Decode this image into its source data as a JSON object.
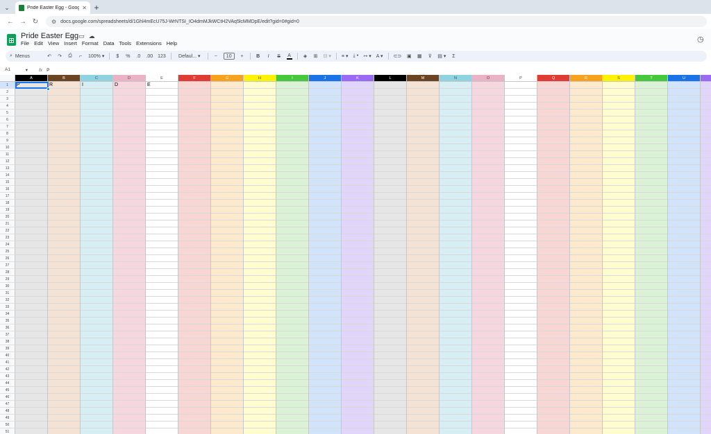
{
  "browser": {
    "tab_title": "Pride Easter Egg - Google Sheets",
    "url": "docs.google.com/spreadsheets/d/1Ghl4mEcU75J-WrNTSI_IO4dmMJkWCtH2VAq5lcMMDpE/edit?gid=0#gid=0"
  },
  "app": {
    "title": "Pride Easter Egg",
    "menu": [
      "File",
      "Edit",
      "View",
      "Insert",
      "Format",
      "Data",
      "Tools",
      "Extensions",
      "Help"
    ]
  },
  "toolbar": {
    "search_label": "Menus",
    "zoom": "100%",
    "currency": "$",
    "percent": "%",
    "decimal_decrease": ".0",
    "decimal_increase": ".00",
    "number_format": "123",
    "font": "Defaul...",
    "font_size": "10",
    "bold": "B",
    "italic": "I",
    "strike": "S",
    "text_color": "A",
    "sum": "Σ"
  },
  "formula_bar": {
    "name_box": "A1",
    "fx": "fx",
    "value": "P"
  },
  "grid": {
    "columns": [
      {
        "label": "A",
        "header_color": "#000000",
        "header_text": "#ffffff",
        "fill": "#e6e6e6"
      },
      {
        "label": "B",
        "header_color": "#6b4423",
        "header_text": "#ffffff",
        "fill": "#f4e3d5"
      },
      {
        "label": "C",
        "header_color": "#8fd3e3",
        "header_text": "#444746",
        "fill": "#d8eef5"
      },
      {
        "label": "D",
        "header_color": "#eab2c4",
        "header_text": "#444746",
        "fill": "#f6d7e0"
      },
      {
        "label": "E",
        "header_color": "#ffffff",
        "header_text": "#444746",
        "fill": "#ffffff"
      },
      {
        "label": "F",
        "header_color": "#e03b35",
        "header_text": "#ffffff",
        "fill": "#f8d6d4"
      },
      {
        "label": "G",
        "header_color": "#f7a11c",
        "header_text": "#ffffff",
        "fill": "#fde9cc"
      },
      {
        "label": "H",
        "header_color": "#fff200",
        "header_text": "#444746",
        "fill": "#fffccf"
      },
      {
        "label": "I",
        "header_color": "#45c83b",
        "header_text": "#ffffff",
        "fill": "#dcf2d7"
      },
      {
        "label": "J",
        "header_color": "#1a73e8",
        "header_text": "#ffffff",
        "fill": "#d2e3fc"
      },
      {
        "label": "K",
        "header_color": "#9a6af5",
        "header_text": "#ffffff",
        "fill": "#e1d5fb"
      },
      {
        "label": "L",
        "header_color": "#000000",
        "header_text": "#ffffff",
        "fill": "#e6e6e6"
      },
      {
        "label": "M",
        "header_color": "#6b4423",
        "header_text": "#ffffff",
        "fill": "#f4e3d5"
      },
      {
        "label": "N",
        "header_color": "#8fd3e3",
        "header_text": "#444746",
        "fill": "#d8eef5"
      },
      {
        "label": "O",
        "header_color": "#eab2c4",
        "header_text": "#444746",
        "fill": "#f6d7e0"
      },
      {
        "label": "P",
        "header_color": "#ffffff",
        "header_text": "#444746",
        "fill": "#ffffff"
      },
      {
        "label": "Q",
        "header_color": "#e03b35",
        "header_text": "#ffffff",
        "fill": "#f8d6d4"
      },
      {
        "label": "R",
        "header_color": "#f7a11c",
        "header_text": "#ffffff",
        "fill": "#fde9cc"
      },
      {
        "label": "S",
        "header_color": "#fff200",
        "header_text": "#444746",
        "fill": "#fffccf"
      },
      {
        "label": "T",
        "header_color": "#45c83b",
        "header_text": "#ffffff",
        "fill": "#dcf2d7"
      },
      {
        "label": "U",
        "header_color": "#1a73e8",
        "header_text": "#ffffff",
        "fill": "#d2e3fc"
      },
      {
        "label": "",
        "header_color": "#9a6af5",
        "header_text": "#ffffff",
        "fill": "#e1d5fb"
      }
    ],
    "row_count": 51,
    "cells": [
      {
        "col": 0,
        "row": 1,
        "value": "P"
      },
      {
        "col": 1,
        "row": 1,
        "value": "R"
      },
      {
        "col": 2,
        "row": 1,
        "value": "I"
      },
      {
        "col": 3,
        "row": 1,
        "value": "D"
      },
      {
        "col": 4,
        "row": 1,
        "value": "E"
      }
    ],
    "selected_cell": "A1"
  }
}
